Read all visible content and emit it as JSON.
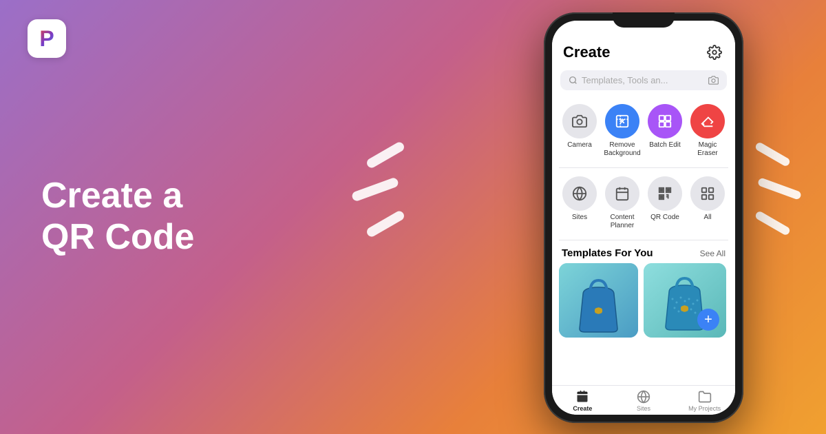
{
  "background": {
    "gradient": "135deg, #9b6fc8, #c4608a, #e8803a, #f0a030"
  },
  "logo": {
    "letter": "P"
  },
  "headline": {
    "line1": "Create a",
    "line2": "QR Code"
  },
  "phone": {
    "header": {
      "title": "Create",
      "gear_icon": "⚙"
    },
    "search": {
      "placeholder": "Templates, Tools an...",
      "camera_icon": "📷"
    },
    "tools_row1": [
      {
        "label": "Camera",
        "icon_type": "camera",
        "bg": "#e5e5ea"
      },
      {
        "label": "Remove\nBackground",
        "icon_type": "remove-bg",
        "bg": "#3b82f6"
      },
      {
        "label": "Batch Edit",
        "icon_type": "batch-edit",
        "bg": "#a855f7"
      },
      {
        "label": "Magic\nEraser",
        "icon_type": "magic-eraser",
        "bg": "#ef4444"
      }
    ],
    "tools_row2": [
      {
        "label": "Sites",
        "icon_type": "globe",
        "bg": "#e5e5ea"
      },
      {
        "label": "Content\nPlanner",
        "icon_type": "calendar",
        "bg": "#e5e5ea"
      },
      {
        "label": "QR\nCode",
        "icon_type": "qr",
        "bg": "#e5e5ea"
      },
      {
        "label": "All",
        "icon_type": "grid",
        "bg": "#e5e5ea"
      }
    ],
    "templates": {
      "title": "Templates For You",
      "see_all": "See All"
    },
    "bottom_nav": [
      {
        "label": "Create",
        "icon": "create",
        "active": true
      },
      {
        "label": "Sites",
        "icon": "globe",
        "active": false
      },
      {
        "label": "My Projects",
        "icon": "folder",
        "active": false
      }
    ]
  }
}
